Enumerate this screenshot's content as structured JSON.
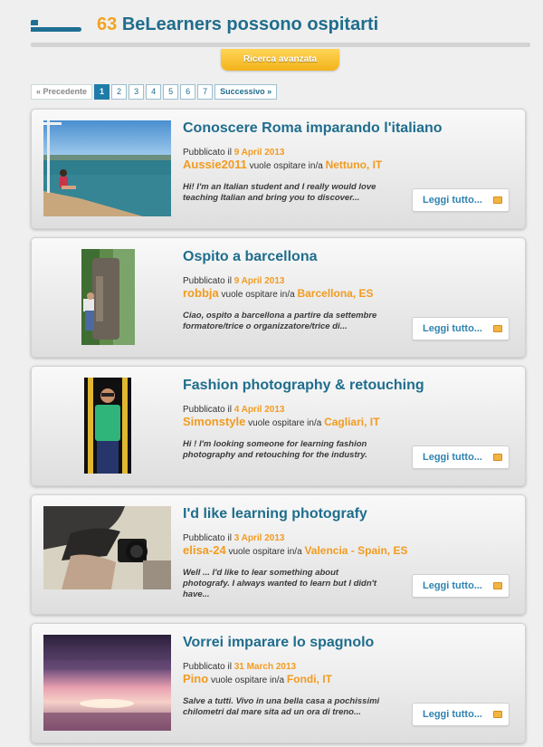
{
  "header": {
    "count": "63",
    "title": "BeLearners possono ospitarti",
    "advanced_search": "Ricerca avanzata"
  },
  "pagination": {
    "prev": "« Precedente",
    "pages": [
      "1",
      "2",
      "3",
      "4",
      "5",
      "6",
      "7"
    ],
    "active": "1",
    "next": "Successivo »"
  },
  "labels": {
    "published": "Pubblicato il",
    "wants_host": "vuole ospitare in/a",
    "read_more": "Leggi tutto..."
  },
  "listings": [
    {
      "title": "Conoscere Roma imparando l'italiano",
      "date": "9 April 2013",
      "user": "Aussie2011",
      "place": "Nettuno, IT",
      "description": "Hi! I'm an Italian student and I really would love teaching Italian and bring you to discover..."
    },
    {
      "title": "Ospito a barcellona",
      "date": "9 April 2013",
      "user": "robbja",
      "place": "Barcellona, ES",
      "description": "Ciao, ospito a barcellona a partire da settembre formatore/trice o organizzatore/trice di..."
    },
    {
      "title": "Fashion photography & retouching",
      "date": "4 April 2013",
      "user": "Simonstyle",
      "place": "Cagliari, IT",
      "description": "Hi ! I'm looking someone for learning fashion photography and retouching for the industry."
    },
    {
      "title": "I'd like learning photografy",
      "date": "3 April 2013",
      "user": "elisa-24",
      "place": "Valencia - Spain, ES",
      "description": "Well ... I'd like to lear something about photografy. I always wanted to learn but I didn't have..."
    },
    {
      "title": "Vorrei imparare lo spagnolo",
      "date": "31 March 2013",
      "user": "Pino",
      "place": "Fondi, IT",
      "description": "Salve a tutti. Vivo in una bella casa a pochissimi chilometri dal mare sita ad un ora di treno..."
    }
  ]
}
